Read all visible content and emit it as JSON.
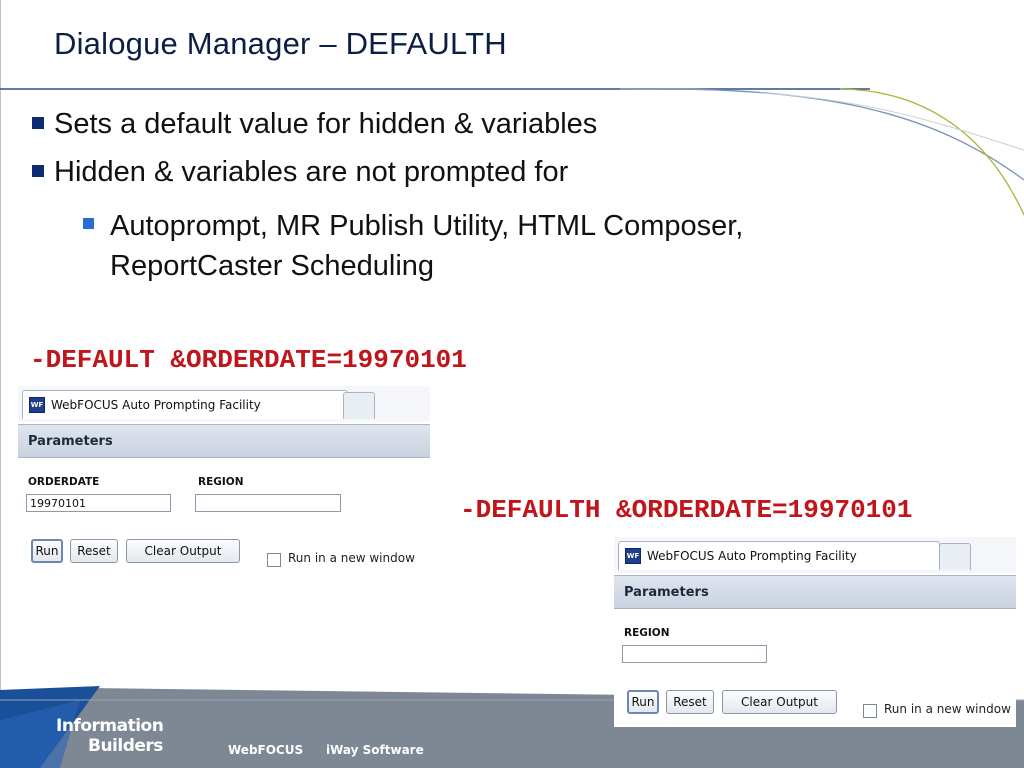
{
  "slide": {
    "title": "Dialogue Manager – DEFAULTH",
    "bullets": [
      "Sets a default value for hidden & variables",
      "Hidden & variables are not prompted for"
    ],
    "sub_bullets": [
      "Autoprompt, MR Publish Utility, HTML Composer, ReportCaster Scheduling"
    ],
    "code_default": "-DEFAULT &ORDERDATE=19970101",
    "code_defaulth": "-DEFAULTH &ORDERDATE=19970101"
  },
  "dialog_default": {
    "tab_title": "WebFOCUS Auto Prompting Facility",
    "tab_icon": "wf-icon",
    "icon_text": "WF",
    "section": "Parameters",
    "fields": [
      {
        "label": "ORDERDATE",
        "value": "19970101"
      },
      {
        "label": "REGION",
        "value": ""
      }
    ],
    "buttons": [
      "Run",
      "Reset",
      "Clear Output"
    ],
    "checkbox_label": "Run in a new window",
    "checkbox_checked": false
  },
  "dialog_defaulth": {
    "tab_title": "WebFOCUS Auto Prompting Facility",
    "tab_icon": "wf-icon",
    "icon_text": "WF",
    "section": "Parameters",
    "fields": [
      {
        "label": "REGION",
        "value": ""
      }
    ],
    "buttons": [
      "Run",
      "Reset",
      "Clear Output"
    ],
    "checkbox_label": "Run in a new window",
    "checkbox_checked": false
  },
  "footer": {
    "logo_line1": "Information",
    "logo_line2": "Builders",
    "products": [
      "WebFOCUS",
      "iWay Software"
    ]
  },
  "colors": {
    "title": "#0d1e44",
    "code": "#c0151b",
    "bullet": "#0b2c72",
    "sub_bullet": "#2c6bd0",
    "footer_band": "#7e8894",
    "footer_accent": "#1a4f9a"
  }
}
